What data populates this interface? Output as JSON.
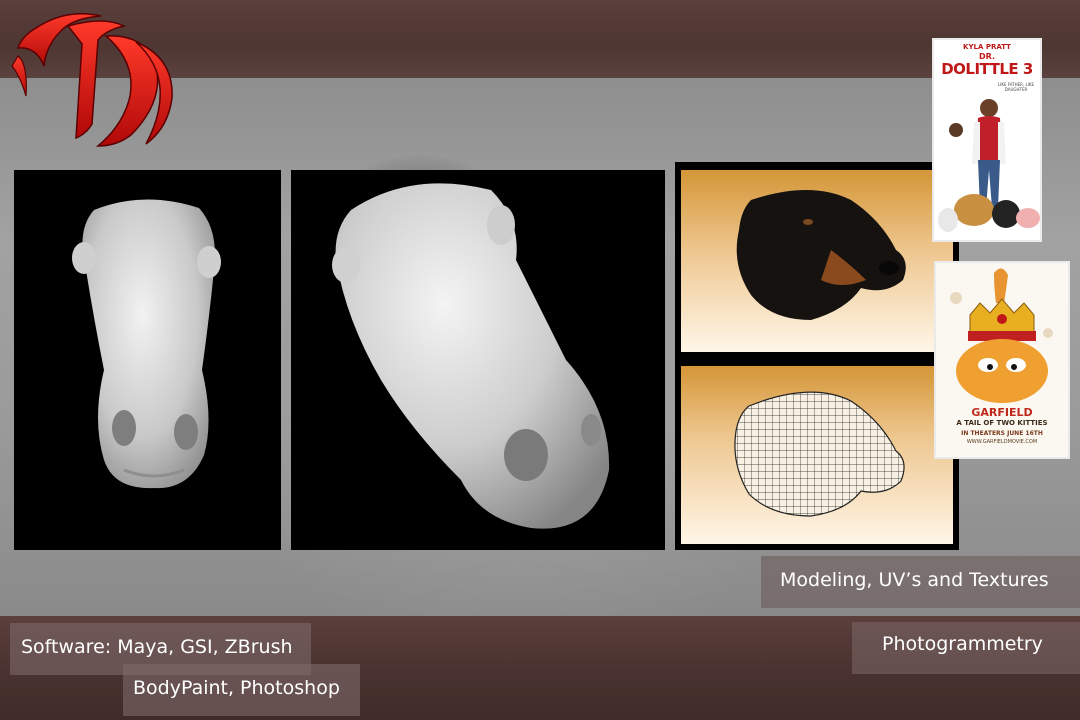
{
  "labels": {
    "modeling": "Modeling, UV’s and Textures",
    "photogrammetry": "Photogrammetry",
    "software_line1": "Software:  Maya, GSI, ZBrush",
    "software_line2": "BodyPaint, Photoshop"
  },
  "posters": {
    "dolittle": {
      "actor": "KYLA PRATT",
      "title_prefix": "DR.",
      "title": "DOLITTLE 3",
      "tagline": "LIKE FATHER, LIKE DAUGHTER"
    },
    "garfield": {
      "title": "GARFIELD",
      "subtitle": "A TAIL OF TWO KITTIES",
      "release": "IN THEATERS JUNE 16TH",
      "url": "WWW.GARFIELDMOVIE.COM"
    }
  },
  "colors": {
    "logo_red": "#e01010",
    "panel_black": "#000000",
    "label_bg": "#786464",
    "background_band": "#9a9a9a"
  },
  "icons": {
    "logo": "red-claw-logo"
  }
}
